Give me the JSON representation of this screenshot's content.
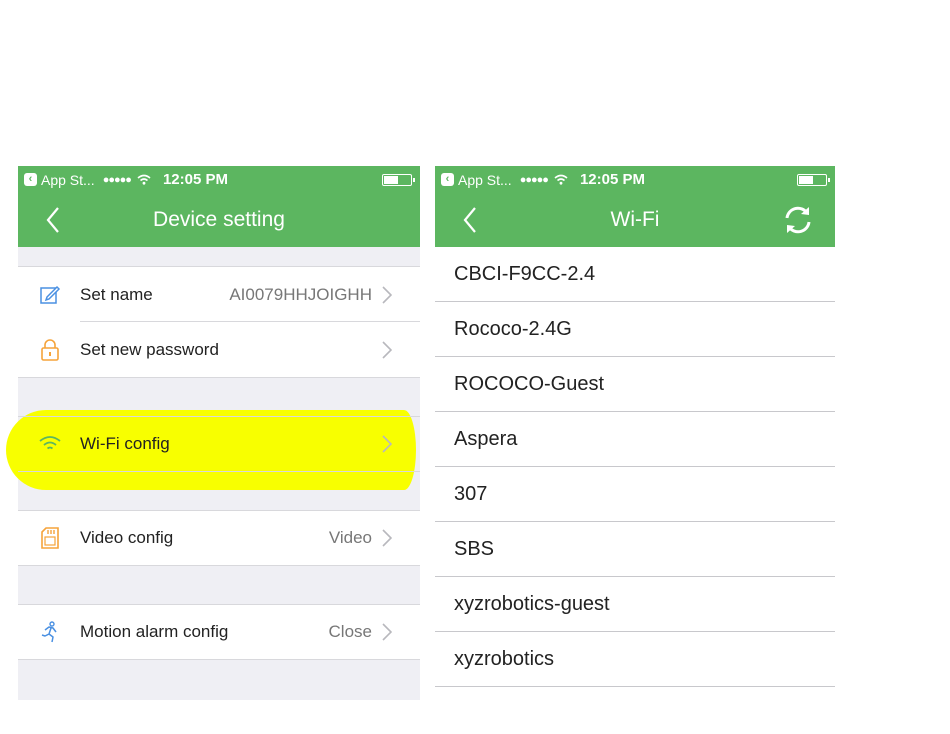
{
  "left": {
    "status": {
      "app_back": "App St...",
      "time": "12:05 PM"
    },
    "nav": {
      "title": "Device setting"
    },
    "rows": {
      "set_name": {
        "label": "Set name",
        "value": "AI0079HHJOIGHH"
      },
      "set_password": {
        "label": "Set new password"
      },
      "wifi_config": {
        "label": "Wi-Fi config"
      },
      "video_config": {
        "label": "Video config",
        "value": "Video"
      },
      "motion_alarm": {
        "label": "Motion alarm config",
        "value": "Close"
      }
    }
  },
  "right": {
    "status": {
      "app_back": "App St...",
      "time": "12:05 PM"
    },
    "nav": {
      "title": "Wi-Fi"
    },
    "networks": [
      "CBCI-F9CC-2.4",
      "Rococo-2.4G",
      "ROCOCO-Guest",
      "Aspera",
      "307",
      "SBS",
      "xyzrobotics-guest",
      "xyzrobotics"
    ]
  },
  "colors": {
    "accent_green": "#5cb660",
    "highlight_yellow": "#f8ff00",
    "icon_orange": "#f5a33a",
    "icon_blue": "#4a90e2"
  }
}
